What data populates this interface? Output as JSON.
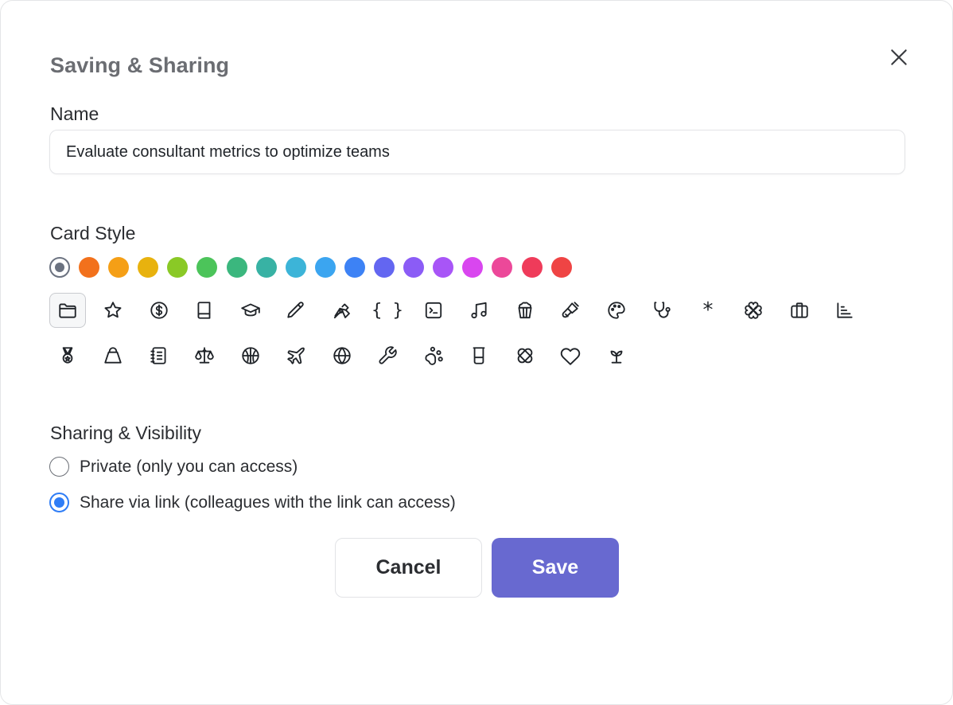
{
  "dialog": {
    "title": "Saving & Sharing",
    "close_icon": "close-icon"
  },
  "name_section": {
    "label": "Name",
    "value": "Evaluate consultant metrics to optimize teams"
  },
  "card_style": {
    "label": "Card Style",
    "colors": [
      {
        "name": "default",
        "hex": "#6b7280",
        "selected": true
      },
      {
        "name": "orange-red",
        "hex": "#f2711c"
      },
      {
        "name": "orange",
        "hex": "#f59f16"
      },
      {
        "name": "yellow",
        "hex": "#e8b20e"
      },
      {
        "name": "lime",
        "hex": "#8ac926"
      },
      {
        "name": "green",
        "hex": "#4cc45a"
      },
      {
        "name": "emerald",
        "hex": "#3bb77e"
      },
      {
        "name": "teal",
        "hex": "#38b2a4"
      },
      {
        "name": "cyan",
        "hex": "#3cb4d8"
      },
      {
        "name": "sky",
        "hex": "#3ba5f0"
      },
      {
        "name": "blue",
        "hex": "#3d82f5"
      },
      {
        "name": "indigo",
        "hex": "#6366f1"
      },
      {
        "name": "violet",
        "hex": "#8b5cf6"
      },
      {
        "name": "purple",
        "hex": "#a855f7"
      },
      {
        "name": "fuchsia",
        "hex": "#d946ef"
      },
      {
        "name": "pink",
        "hex": "#ec4899"
      },
      {
        "name": "rose",
        "hex": "#ef3b5a"
      },
      {
        "name": "red",
        "hex": "#ef4444"
      }
    ],
    "icons_row1": [
      "folder-icon",
      "star-icon",
      "dollar-icon",
      "book-icon",
      "graduation-cap-icon",
      "pencil-icon",
      "pen-tool-icon",
      "braces-icon",
      "terminal-icon",
      "music-icon",
      "popcorn-icon",
      "paintbrush-icon",
      "palette-icon",
      "stethoscope-icon",
      "asterisk-icon",
      "clover-icon",
      "briefcase-icon",
      "bar-chart-icon"
    ],
    "icons_row2": [
      "medal-icon",
      "kettlebell-icon",
      "notebook-icon",
      "scale-icon",
      "basketball-icon",
      "plane-icon",
      "globe-icon",
      "wrench-icon",
      "paw-icon",
      "beaker-icon",
      "bandage-icon",
      "heart-icon",
      "sprout-icon"
    ],
    "selected_icon": "folder-icon",
    "braces_glyph": "{ }",
    "asterisk_glyph": "*"
  },
  "sharing": {
    "label": "Sharing & Visibility",
    "options": [
      {
        "label": "Private (only you can access)",
        "checked": false
      },
      {
        "label": "Share via link (colleagues with the link can access)",
        "checked": true
      }
    ]
  },
  "actions": {
    "cancel_label": "Cancel",
    "save_label": "Save",
    "save_color": "#6869d0"
  }
}
